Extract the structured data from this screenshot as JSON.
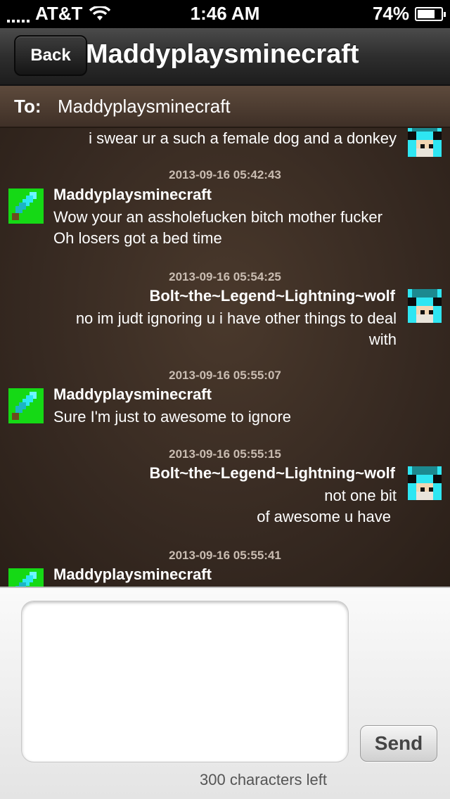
{
  "status_bar": {
    "carrier": "AT&T",
    "time": "1:46 AM",
    "battery_percent": "74%",
    "battery_level": 0.74,
    "icons": [
      "signal-dots-icon",
      "wifi-icon",
      "battery-icon"
    ]
  },
  "nav": {
    "back_label": "Back",
    "title": "Maddyplaysminecraft"
  },
  "to": {
    "label": "To:",
    "value": "Maddyplaysminecraft"
  },
  "messages": {
    "partial_top": "i swear ur a such a female dog and a donkey",
    "items": [
      {
        "timestamp": "2013-09-16 05:42:43",
        "sender": "Maddyplaysminecraft",
        "lines": [
          "Wow your an assholefucken bitch mother fucker",
          "Oh losers got a bed time"
        ]
      },
      {
        "timestamp": "2013-09-16 05:54:25",
        "sender": "Bolt~the~Legend~Lightning~wolf",
        "lines": [
          "no im judt ignoring u i have other things to deal",
          "with"
        ]
      },
      {
        "timestamp": "2013-09-16 05:55:07",
        "sender": "Maddyplaysminecraft",
        "lines": [
          "Sure I'm just to awesome to ignore"
        ]
      },
      {
        "timestamp": "2013-09-16 05:55:15",
        "sender": "Bolt~the~Legend~Lightning~wolf",
        "lines": [
          "not one bit",
          "of awesome u have"
        ]
      },
      {
        "timestamp": "2013-09-16 05:55:41",
        "sender": "Maddyplaysminecraft",
        "lines": []
      }
    ]
  },
  "compose": {
    "input_value": "",
    "send_label": "Send",
    "chars_left": "300 characters left"
  },
  "colors": {
    "sword_avatar_bg": "#15d915",
    "wolf_avatar_cyan": "#2ee6f2",
    "messages_bg": "#3a2c22"
  }
}
